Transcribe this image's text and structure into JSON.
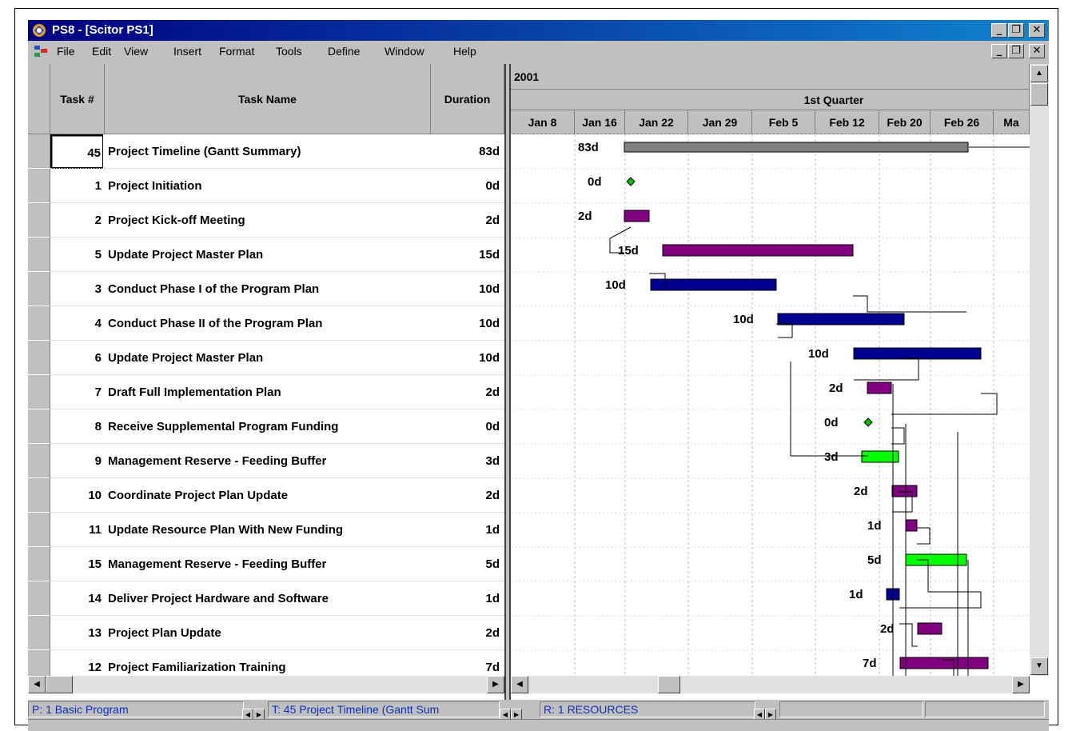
{
  "window": {
    "title": "PS8 - [Scitor PS1]"
  },
  "menu": [
    "File",
    "Edit",
    "View",
    "Insert",
    "Format",
    "Tools",
    "Define",
    "Window",
    "Help"
  ],
  "columns": {
    "task_num": "Task #",
    "task_name": "Task Name",
    "duration": "Duration"
  },
  "timescale": {
    "year": "2001",
    "quarter": "1st Quarter",
    "weeks": [
      "Jan 8",
      "Jan 16",
      "Jan 22",
      "Jan 29",
      "Feb 5",
      "Feb 12",
      "Feb 20",
      "Feb 26",
      "Ma"
    ]
  },
  "tasks": [
    {
      "num": "45",
      "name": "Project Timeline (Gantt Summary)",
      "dur": "83d"
    },
    {
      "num": "1",
      "name": "Project Initiation",
      "dur": "0d"
    },
    {
      "num": "2",
      "name": "Project Kick-off Meeting",
      "dur": "2d"
    },
    {
      "num": "5",
      "name": "Update Project Master Plan",
      "dur": "15d"
    },
    {
      "num": "3",
      "name": "Conduct Phase I of the Program Plan",
      "dur": "10d"
    },
    {
      "num": "4",
      "name": "Conduct Phase II of the Program Plan",
      "dur": "10d"
    },
    {
      "num": "6",
      "name": "Update Project Master Plan",
      "dur": "10d"
    },
    {
      "num": "7",
      "name": "Draft Full Implementation Plan",
      "dur": "2d"
    },
    {
      "num": "8",
      "name": "Receive Supplemental Program Funding",
      "dur": "0d"
    },
    {
      "num": "9",
      "name": "Management Reserve - Feeding Buffer",
      "dur": "3d"
    },
    {
      "num": "10",
      "name": "Coordinate Project Plan Update",
      "dur": "2d"
    },
    {
      "num": "11",
      "name": "Update Resource Plan With New Funding",
      "dur": "1d"
    },
    {
      "num": "15",
      "name": "Management Reserve - Feeding Buffer",
      "dur": "5d"
    },
    {
      "num": "14",
      "name": "Deliver Project Hardware and Software",
      "dur": "1d"
    },
    {
      "num": "13",
      "name": "Project Plan Update",
      "dur": "2d"
    },
    {
      "num": "12",
      "name": "Project Familiarization Training",
      "dur": "7d"
    }
  ],
  "status": {
    "p": "P: 1 Basic Program",
    "t": "T: 45 Project Timeline (Gantt Sum",
    "r": "R: 1 RESOURCES"
  },
  "colors": {
    "summary": "#808080",
    "task_purple": "#800080",
    "task_blue": "#000090",
    "buffer_green": "#00ff00",
    "milestone": "#00c000"
  }
}
